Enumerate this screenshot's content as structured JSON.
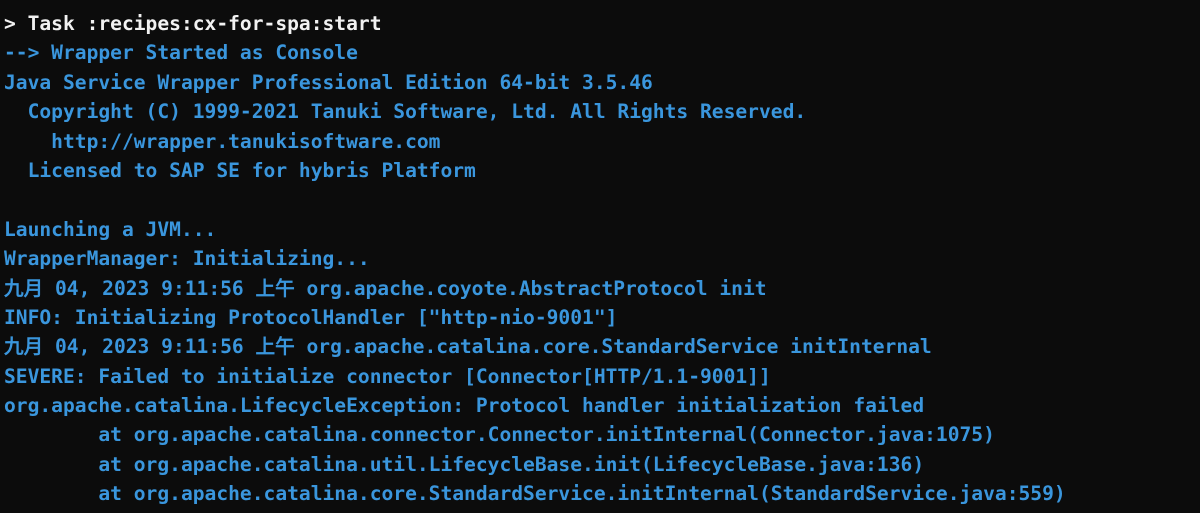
{
  "terminal": {
    "colors": {
      "background": "#0c0c0c",
      "command_text": "#f2f2f2",
      "output_text": "#3a96dd"
    },
    "lines": [
      "> Task :recipes:cx-for-spa:start",
      "--> Wrapper Started as Console",
      "Java Service Wrapper Professional Edition 64-bit 3.5.46",
      "  Copyright (C) 1999-2021 Tanuki Software, Ltd. All Rights Reserved.",
      "    http://wrapper.tanukisoftware.com",
      "  Licensed to SAP SE for hybris Platform",
      "",
      "Launching a JVM...",
      "WrapperManager: Initializing...",
      "九月 04, 2023 9:11:56 上午 org.apache.coyote.AbstractProtocol init",
      "INFO: Initializing ProtocolHandler [\"http-nio-9001\"]",
      "九月 04, 2023 9:11:56 上午 org.apache.catalina.core.StandardService initInternal",
      "SEVERE: Failed to initialize connector [Connector[HTTP/1.1-9001]]",
      "org.apache.catalina.LifecycleException: Protocol handler initialization failed",
      "        at org.apache.catalina.connector.Connector.initInternal(Connector.java:1075)",
      "        at org.apache.catalina.util.LifecycleBase.init(LifecycleBase.java:136)",
      "        at org.apache.catalina.core.StandardService.initInternal(StandardService.java:559)"
    ]
  }
}
